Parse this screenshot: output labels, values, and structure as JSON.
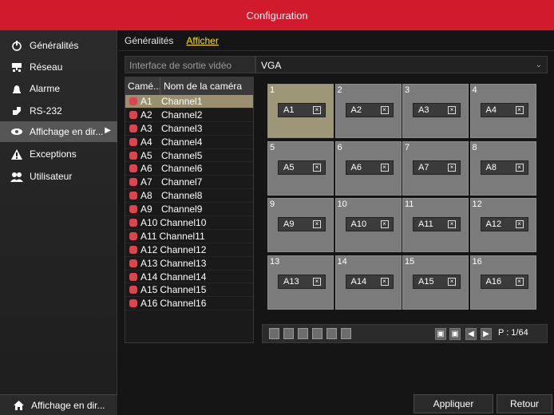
{
  "title": "Configuration",
  "sidebar": {
    "items": [
      {
        "label": "Généralités",
        "icon": "settings-knob-icon"
      },
      {
        "label": "Réseau",
        "icon": "network-icon"
      },
      {
        "label": "Alarme",
        "icon": "alarm-icon"
      },
      {
        "label": "RS-232",
        "icon": "rs232-icon"
      },
      {
        "label": "Affichage en dir...",
        "icon": "eye-icon"
      },
      {
        "label": "Exceptions",
        "icon": "warning-icon"
      },
      {
        "label": "Utilisateur",
        "icon": "users-icon"
      }
    ],
    "active_index": 4,
    "bottom_label": "Affichage en dir..."
  },
  "tabs": [
    {
      "label": "Généralités"
    },
    {
      "label": "Afficher"
    }
  ],
  "output": {
    "label": "Interface de sortie vidéo",
    "value": "VGA"
  },
  "camera_table": {
    "col_camera": "Camé...",
    "col_name": "Nom de la caméra",
    "rows": [
      {
        "id": "A1",
        "name": "Channel1"
      },
      {
        "id": "A2",
        "name": "Channel2"
      },
      {
        "id": "A3",
        "name": "Channel3"
      },
      {
        "id": "A4",
        "name": "Channel4"
      },
      {
        "id": "A5",
        "name": "Channel5"
      },
      {
        "id": "A6",
        "name": "Channel6"
      },
      {
        "id": "A7",
        "name": "Channel7"
      },
      {
        "id": "A8",
        "name": "Channel8"
      },
      {
        "id": "A9",
        "name": "Channel9"
      },
      {
        "id": "A10",
        "name": "Channel10"
      },
      {
        "id": "A11",
        "name": "Channel11"
      },
      {
        "id": "A12",
        "name": "Channel12"
      },
      {
        "id": "A13",
        "name": "Channel13"
      },
      {
        "id": "A14",
        "name": "Channel14"
      },
      {
        "id": "A15",
        "name": "Channel15"
      },
      {
        "id": "A16",
        "name": "Channel16"
      }
    ]
  },
  "grid": {
    "cells": [
      {
        "num": "1",
        "cam": "A1"
      },
      {
        "num": "2",
        "cam": "A2"
      },
      {
        "num": "3",
        "cam": "A3"
      },
      {
        "num": "4",
        "cam": "A4"
      },
      {
        "num": "5",
        "cam": "A5"
      },
      {
        "num": "6",
        "cam": "A6"
      },
      {
        "num": "7",
        "cam": "A7"
      },
      {
        "num": "8",
        "cam": "A8"
      },
      {
        "num": "9",
        "cam": "A9"
      },
      {
        "num": "10",
        "cam": "A10"
      },
      {
        "num": "11",
        "cam": "A11"
      },
      {
        "num": "12",
        "cam": "A12"
      },
      {
        "num": "13",
        "cam": "A13"
      },
      {
        "num": "14",
        "cam": "A14"
      },
      {
        "num": "15",
        "cam": "A15"
      },
      {
        "num": "16",
        "cam": "A16"
      }
    ]
  },
  "pager": {
    "label": "P : 1/64"
  },
  "buttons": {
    "apply": "Appliquer",
    "back": "Retour"
  },
  "colors": {
    "accent": "#d11a2c",
    "active_tab": "#ffe100",
    "selected_row": "#9a9070"
  }
}
